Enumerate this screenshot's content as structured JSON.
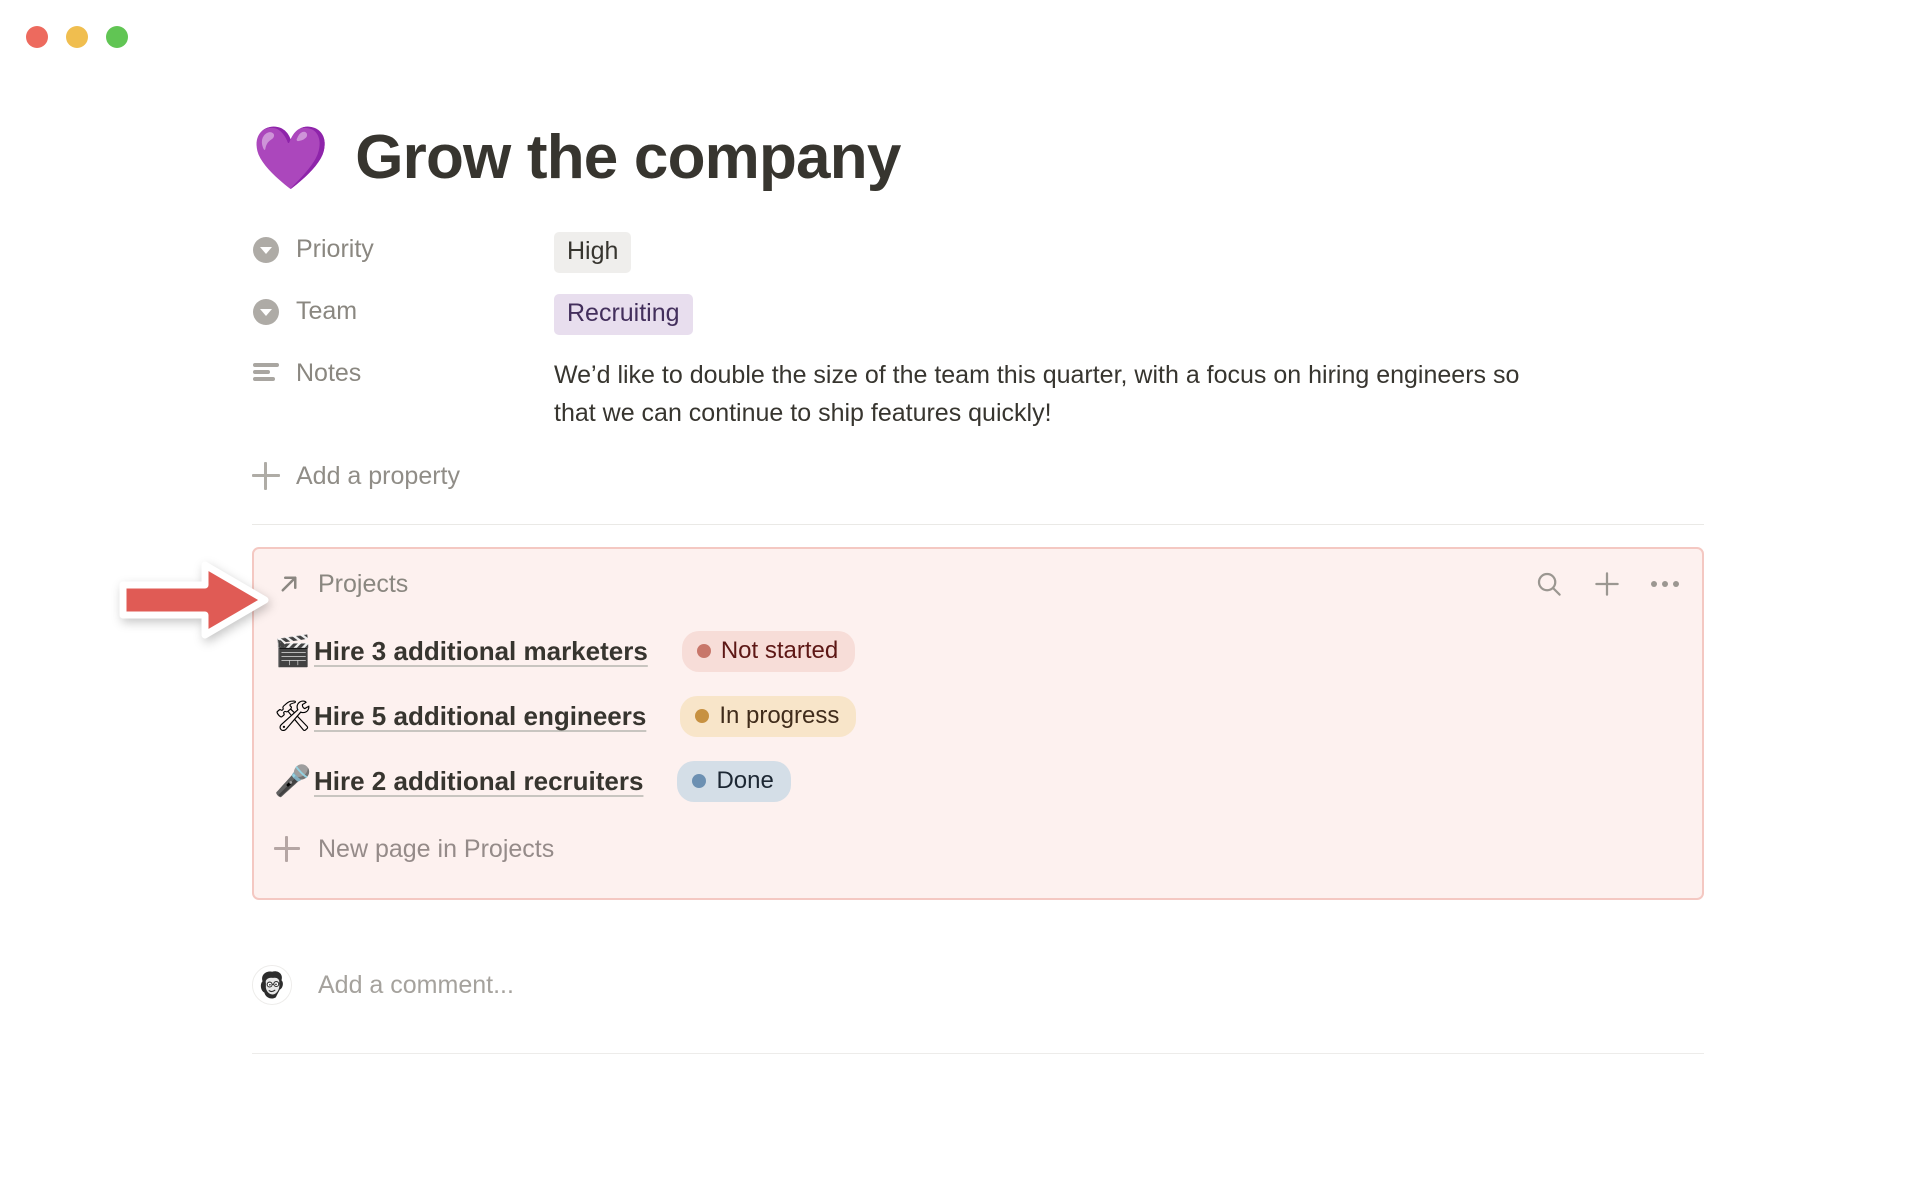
{
  "window": {
    "traffic_lights": [
      "close",
      "minimize",
      "maximize"
    ],
    "colors": {
      "close": "#ED6A5E",
      "minimize": "#F0BE4F",
      "maximize": "#61C554"
    }
  },
  "page": {
    "emoji": "💜",
    "title": "Grow the company"
  },
  "properties": [
    {
      "icon": "select-icon",
      "label": "Priority",
      "value": "High",
      "value_type": "tag",
      "tag_style": "gray",
      "tag_bg": "#EFEEEC",
      "tag_fg": "#37352F"
    },
    {
      "icon": "select-icon",
      "label": "Team",
      "value": "Recruiting",
      "value_type": "tag",
      "tag_style": "purple",
      "tag_bg": "#E8DEEE",
      "tag_fg": "#432F5C"
    },
    {
      "icon": "text-lines-icon",
      "label": "Notes",
      "value": "We’d like to double the size of the team this quarter, with a focus on hiring engineers so that we can continue to ship features quickly!",
      "value_type": "text"
    }
  ],
  "add_property": {
    "icon": "plus-icon",
    "label": "Add a property"
  },
  "projects_panel": {
    "accent_border": "#F4C8C2",
    "background": "#FDF1EF",
    "header": {
      "icon": "arrow-up-right-icon",
      "title": "Projects",
      "actions": [
        {
          "icon": "search-icon",
          "name": "search"
        },
        {
          "icon": "plus-icon",
          "name": "add"
        },
        {
          "icon": "ellipsis-icon",
          "name": "more-options"
        }
      ]
    },
    "rows": [
      {
        "emoji": "🎬",
        "emoji_name": "clapper-board-icon",
        "name": "Hire 3 additional marketers",
        "status": "Not started",
        "status_key": "not-started",
        "status_bg": "#F7DDD8",
        "status_fg": "#5D1715",
        "status_dot": "#C8776A"
      },
      {
        "emoji": "🛠",
        "emoji_name": "hammer-and-wrench-icon",
        "name": "Hire 5 additional engineers",
        "status": "In progress",
        "status_key": "in-progress",
        "status_bg": "#F8E5C9",
        "status_fg": "#402C1B",
        "status_dot": "#C79141"
      },
      {
        "emoji": "🎤",
        "emoji_name": "microphone-icon",
        "name": "Hire 2 additional recruiters",
        "status": "Done",
        "status_key": "done",
        "status_bg": "#D4DEE7",
        "status_fg": "#1C2733",
        "status_dot": "#6C90B2"
      }
    ],
    "new_page": {
      "icon": "plus-icon",
      "label": "New page in Projects"
    }
  },
  "annotation": {
    "type": "arrow-right",
    "color": "#E05B55",
    "points_to": "projects-panel-header"
  },
  "comment": {
    "avatar": "user-avatar",
    "placeholder": "Add a comment..."
  }
}
